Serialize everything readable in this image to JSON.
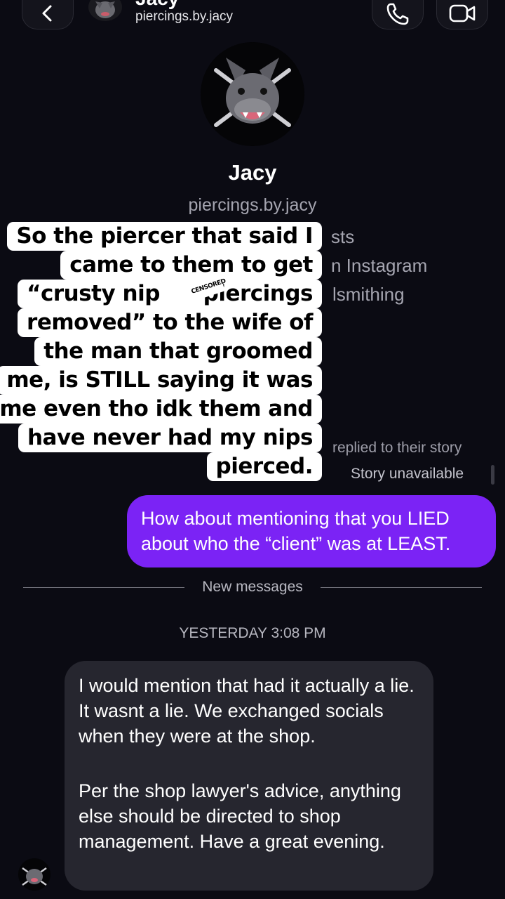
{
  "header": {
    "name": "Jacy",
    "username": "piercings.by.jacy",
    "back_icon": "chevron-left-icon",
    "call_icon": "phone-icon",
    "video_icon": "video-camera-icon"
  },
  "profile": {
    "name": "Jacy",
    "username": "piercings.by.jacy",
    "partial_lines": [
      "sts",
      "n Instagram",
      "lsmithing"
    ]
  },
  "overlay_caption": {
    "lines": [
      "So the piercer that said I",
      "came to them to get",
      "“crusty nip",
      "piercings",
      "removed” to the wife of",
      "the man that groomed",
      "me, is STILL saying it was",
      "me even tho idk them and",
      "have never had my nips",
      "pierced."
    ],
    "censor_label": "CENSORED"
  },
  "story_reply": {
    "replied_text": "replied to their story",
    "story_status": "Story unavailable"
  },
  "sent_message": {
    "text": "How about mentioning that you LIED about who the “client” was at LEAST."
  },
  "divider": {
    "label": "New messages"
  },
  "timestamp": "YESTERDAY 3:08 PM",
  "received_message": {
    "paragraph1": "I would mention that had it actually a lie. It wasnt a lie. We exchanged socials when they were at the shop.",
    "paragraph2": "Per the shop lawyer's advice, anything else should be directed to shop management. Have a great evening."
  },
  "colors": {
    "background": "#0b0b13",
    "sent_bubble": "#7b23f5",
    "received_bubble": "#26262f",
    "caption_bg": "#ffffff"
  }
}
